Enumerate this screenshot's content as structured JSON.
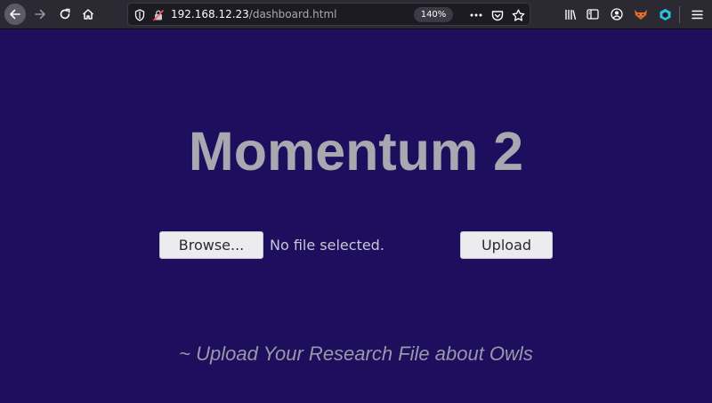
{
  "browser": {
    "url_host": "192.168.12.23",
    "url_path": "/dashboard.html",
    "zoom": "140%",
    "icons": {
      "back": "back-arrow-icon",
      "forward": "forward-arrow-icon",
      "reload": "reload-icon",
      "home": "home-icon",
      "tracking_shield": "shield-icon",
      "insecure": "insecure-lock-icon",
      "page_actions": "more-dots-icon",
      "pocket": "pocket-icon",
      "bookmark": "star-icon",
      "library": "library-icon",
      "sidebar": "sidebar-icon",
      "account": "account-icon",
      "ext_fox": "foxyproxy-icon",
      "ext_cube": "extension-cube-icon",
      "menu": "hamburger-menu-icon"
    }
  },
  "page": {
    "title": "Momentum 2",
    "browse_label": "Browse...",
    "file_status": "No file selected.",
    "upload_label": "Upload",
    "subtitle": "~ Upload Your Research File about Owls",
    "colors": {
      "background": "#1d0e5e",
      "title": "#a8a8b0",
      "subtitle": "#9a98a8"
    }
  }
}
